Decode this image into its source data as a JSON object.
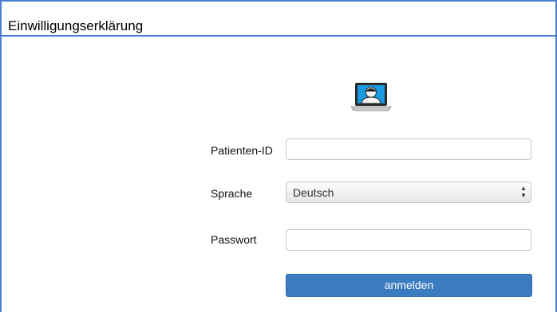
{
  "window": {
    "title": "Einwilligungserklärung"
  },
  "icons": {
    "avatar": "user-laptop-icon",
    "select_arrows": "up-down-arrows-icon"
  },
  "form": {
    "patient_id": {
      "label": "Patienten-ID",
      "value": "",
      "placeholder": ""
    },
    "language": {
      "label": "Sprache",
      "selected": "Deutsch"
    },
    "password": {
      "label": "Passwort",
      "value": "",
      "placeholder": ""
    },
    "submit_label": "anmelden"
  },
  "colors": {
    "accent": "#3b7bbf",
    "frame_border": "#4a7fd0",
    "icon_screen": "#1a9ae0"
  }
}
